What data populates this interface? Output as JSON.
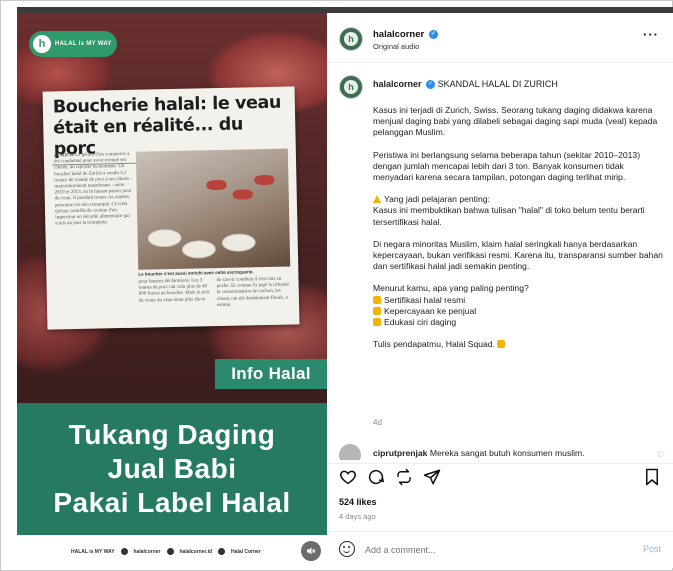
{
  "post": {
    "media": {
      "logo_text": "HALAL is MY WAY",
      "headline": "Boucherie halal: le veau était en réalité... du porc",
      "article_dateline": "ZURICH",
      "article_col_a": "Le gérant d'un commerce a été condamné pour avoir trompé ses clients, un reporter économiste. Un boucher halal de Zurich a vendu 3,1 tonnes de viande de porc à ses clients - majoritairement musulmans - entre 2010 et 2013, en la faisant passer pour du veau. Il pendant toutes ces années, personne n'a rien remarqué. Ce n'est qu'une contrôle de routine d'un inspecteur en sécurité alimentaire qui a mis au jour la tromperie.",
      "article_caption": "Le boucher s'est aussi enrichi avec cette escroquerie.",
      "article_col_b": "pour fausses déclarations. Les 3 tonnes de porc ont valu plus de 40 000 francs au boucher. Mais le prix de vente du veau étant plus élevé.",
      "article_col_c": "de savoir combien il s'est mis en poche. Et comme l'a jugé le tribunal la consommation de cochon, les clients ont été doublement floués, a estimé.",
      "info_tag": "Info Halal",
      "headline_lines": [
        "Tukang Daging",
        "Jual Babi",
        "Pakai Label Halal"
      ],
      "footer_items": [
        "HALAL is MY WAY",
        "halalcorner",
        "halalcorner.id",
        "Halal Corner"
      ]
    },
    "header": {
      "username": "halalcorner",
      "audio": "Original audio",
      "more": "···"
    },
    "caption": {
      "username": "halalcorner",
      "title": "SKANDAL HALAL DI ZURICH",
      "paragraphs": [
        "Kasus ini terjadi di Zurich, Swiss. Seorang tukang daging didakwa karena menjual daging babi yang dilabeli sebagai daging sapi muda (veal) kepada pelanggan Muslim.",
        "Peristiwa ini berlangsung selama beberapa tahun (sekitar 2010–2013) dengan jumlah mencapai lebih dari 3 ton. Banyak konsumen tidak menyadari karena secara tampilan, potongan daging terlihat mirip.",
        "Yang jadi pelajaran penting:\nKasus ini membuktikan bahwa tulisan \"halal\" di toko belum tentu berarti tersertifikasi halal.",
        "Di negara minoritas Muslim, klaim halal seringkali hanya berdasarkan kepercayaan, bukan verifikasi resmi. Karena itu, transparansi sumber bahan dan sertifikasi halal jadi semakin penting."
      ],
      "question": "Menurut kamu, apa yang paling penting?",
      "list": [
        "Sertifikasi halal resmi",
        "Kepercayaan ke penjual",
        "Edukasi ciri daging"
      ],
      "closing": "Tulis pendapatmu, Halal Squad.",
      "time": "4d"
    },
    "comment": {
      "username": "ciprutprenjak",
      "text": "Mereka sangat butuh konsumen muslim."
    },
    "likes": "524 likes",
    "date": "4 days ago",
    "add_comment": {
      "placeholder": "Add a comment...",
      "post_label": "Post"
    }
  }
}
